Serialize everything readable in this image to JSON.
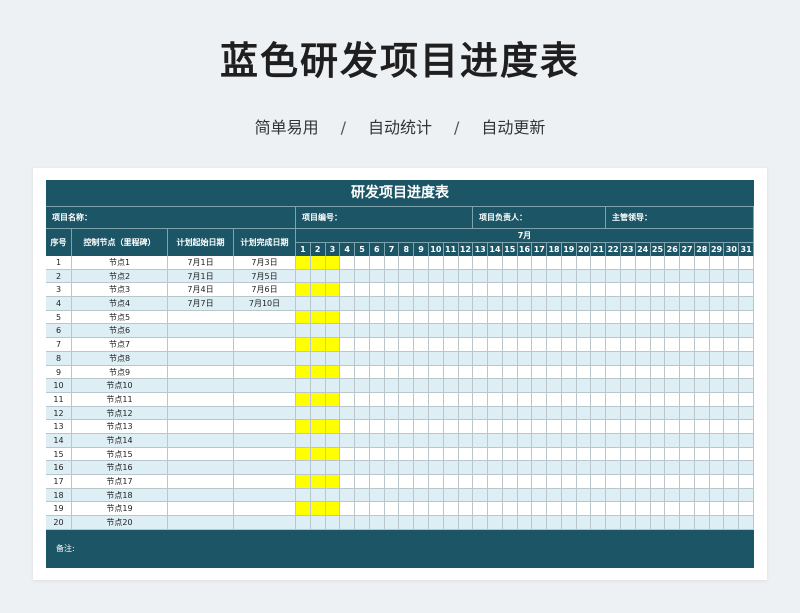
{
  "page_title": "蓝色研发项目进度表",
  "subtitle": {
    "parts": [
      "简单易用",
      "自动统计",
      "自动更新"
    ],
    "separator": "/"
  },
  "sheet": {
    "title": "研发项目进度表",
    "info": [
      {
        "label": "项目名称："
      },
      {
        "label": "项目编号："
      },
      {
        "label": "项目负责人："
      },
      {
        "label": "主管领导："
      }
    ],
    "headers": {
      "seq": "序号",
      "node": "控制节点（里程碑）",
      "start": "计划起始日期",
      "end": "计划完成日期",
      "month": "7月"
    },
    "days": [
      "1",
      "2",
      "3",
      "4",
      "5",
      "6",
      "7",
      "8",
      "9",
      "10",
      "11",
      "12",
      "13",
      "14",
      "15",
      "16",
      "17",
      "18",
      "19",
      "20",
      "21",
      "22",
      "23",
      "24",
      "25",
      "26",
      "27",
      "28",
      "29",
      "30",
      "31"
    ],
    "rows": [
      {
        "seq": "1",
        "node": "节点1",
        "start": "7月1日",
        "end": "7月3日",
        "bar": [
          1,
          3
        ]
      },
      {
        "seq": "2",
        "node": "节点2",
        "start": "7月1日",
        "end": "7月5日",
        "bar": []
      },
      {
        "seq": "3",
        "node": "节点3",
        "start": "7月4日",
        "end": "7月6日",
        "bar": [
          1,
          3
        ]
      },
      {
        "seq": "4",
        "node": "节点4",
        "start": "7月7日",
        "end": "7月10日",
        "bar": []
      },
      {
        "seq": "5",
        "node": "节点5",
        "start": "",
        "end": "",
        "bar": [
          1,
          3
        ]
      },
      {
        "seq": "6",
        "node": "节点6",
        "start": "",
        "end": "",
        "bar": []
      },
      {
        "seq": "7",
        "node": "节点7",
        "start": "",
        "end": "",
        "bar": [
          1,
          3
        ]
      },
      {
        "seq": "8",
        "node": "节点8",
        "start": "",
        "end": "",
        "bar": []
      },
      {
        "seq": "9",
        "node": "节点9",
        "start": "",
        "end": "",
        "bar": [
          1,
          3
        ]
      },
      {
        "seq": "10",
        "node": "节点10",
        "start": "",
        "end": "",
        "bar": []
      },
      {
        "seq": "11",
        "node": "节点11",
        "start": "",
        "end": "",
        "bar": [
          1,
          3
        ]
      },
      {
        "seq": "12",
        "node": "节点12",
        "start": "",
        "end": "",
        "bar": []
      },
      {
        "seq": "13",
        "node": "节点13",
        "start": "",
        "end": "",
        "bar": [
          1,
          3
        ]
      },
      {
        "seq": "14",
        "node": "节点14",
        "start": "",
        "end": "",
        "bar": []
      },
      {
        "seq": "15",
        "node": "节点15",
        "start": "",
        "end": "",
        "bar": [
          1,
          3
        ]
      },
      {
        "seq": "16",
        "node": "节点16",
        "start": "",
        "end": "",
        "bar": []
      },
      {
        "seq": "17",
        "node": "节点17",
        "start": "",
        "end": "",
        "bar": [
          1,
          3
        ]
      },
      {
        "seq": "18",
        "node": "节点18",
        "start": "",
        "end": "",
        "bar": []
      },
      {
        "seq": "19",
        "node": "节点19",
        "start": "",
        "end": "",
        "bar": [
          1,
          3
        ]
      },
      {
        "seq": "20",
        "node": "节点20",
        "start": "",
        "end": "",
        "bar": []
      }
    ],
    "note": "备注:"
  },
  "colors": {
    "header_bg": "#1c5666",
    "bar": "#ffff00",
    "stripe": "#ddeef4"
  }
}
